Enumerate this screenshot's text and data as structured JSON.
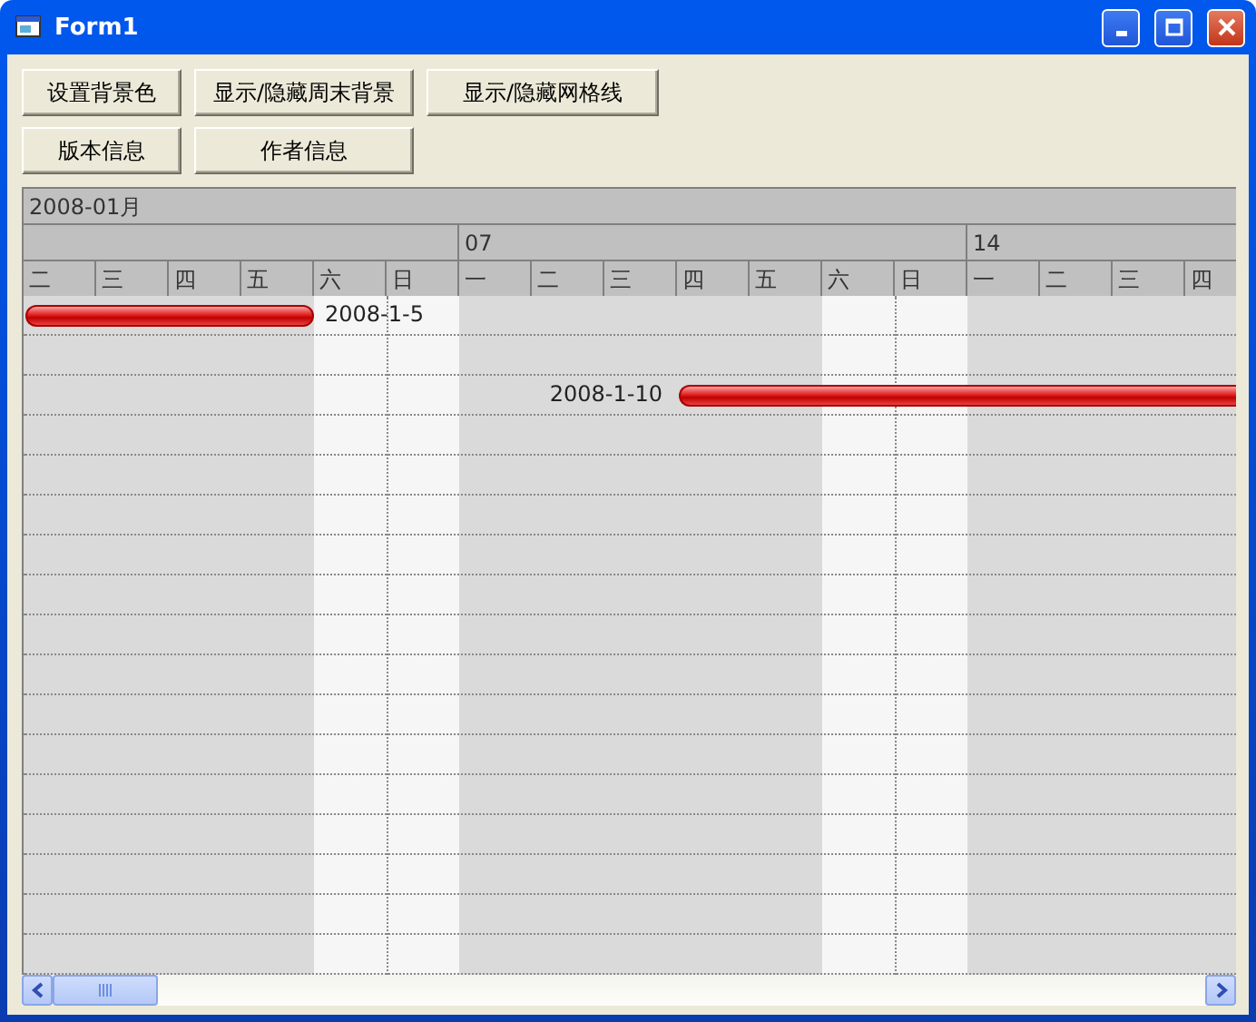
{
  "window": {
    "title": "Form1"
  },
  "toolbar_rows": [
    [
      "设置背景色",
      "显示/隐藏周末背景",
      "显示/隐藏网格线"
    ],
    [
      "版本信息",
      "作者信息"
    ]
  ],
  "timeline": {
    "month": "2008-01月",
    "days": [
      {
        "label": "二",
        "weekend": false
      },
      {
        "label": "三",
        "weekend": false
      },
      {
        "label": "四",
        "weekend": false
      },
      {
        "label": "五",
        "weekend": false
      },
      {
        "label": "六",
        "weekend": true
      },
      {
        "label": "日",
        "weekend": true
      },
      {
        "label": "一",
        "weekend": false,
        "week": "07"
      },
      {
        "label": "二",
        "weekend": false
      },
      {
        "label": "三",
        "weekend": false
      },
      {
        "label": "四",
        "weekend": false
      },
      {
        "label": "五",
        "weekend": false
      },
      {
        "label": "六",
        "weekend": true
      },
      {
        "label": "日",
        "weekend": true
      },
      {
        "label": "一",
        "weekend": false,
        "week": "14"
      },
      {
        "label": "二",
        "weekend": false
      },
      {
        "label": "三",
        "weekend": false
      },
      {
        "label": "四",
        "weekend": false
      }
    ]
  },
  "rows": [
    {
      "task": {
        "label": "2008-1-5",
        "bar": [
          true,
          true,
          true,
          true,
          false,
          false,
          false,
          false,
          false,
          false,
          false,
          false,
          false,
          false,
          false,
          false,
          false
        ]
      }
    },
    {},
    {
      "task": {
        "label": "2008-1-10",
        "bar": [
          false,
          false,
          false,
          false,
          false,
          false,
          false,
          false,
          false,
          true,
          true,
          true,
          true,
          true,
          true,
          true,
          true
        ]
      }
    },
    {},
    {},
    {},
    {},
    {},
    {},
    {},
    {},
    {},
    {},
    {},
    {},
    {},
    {}
  ]
}
